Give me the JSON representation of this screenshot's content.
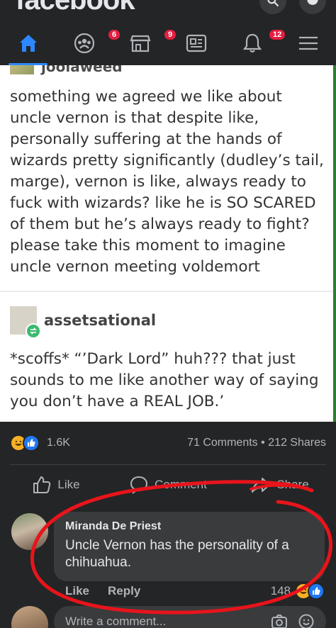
{
  "app": {
    "brand": "facebook"
  },
  "nav": {
    "items": [
      {
        "name": "home",
        "badge": ""
      },
      {
        "name": "groups",
        "badge": "6"
      },
      {
        "name": "marketplace",
        "badge": "9"
      },
      {
        "name": "news",
        "badge": ""
      },
      {
        "name": "notifications",
        "badge": "12"
      },
      {
        "name": "menu",
        "badge": ""
      }
    ]
  },
  "post_image": {
    "first_user": "joolaweed",
    "first_text": "something we agreed we like about uncle vernon is that despite like, personally suffering at the hands of wizards pretty significantly (dudley’s tail, marge), vernon is like, always ready to fuck with wizards? like he is SO SCARED of them but he’s always ready to fight? please take this moment to imagine uncle vernon meeting voldemort",
    "second_user": "assetsational",
    "second_text": "*scoffs* “’Dark Lord” huh??? that just sounds to me like another way of saying you don’t have a REAL JOB.’"
  },
  "reactions": {
    "count": "1.6K",
    "engagement": "71 Comments • 212 Shares"
  },
  "actions": {
    "like": "Like",
    "comment": "Comment",
    "share": "Share"
  },
  "comment": {
    "author": "Miranda De Priest",
    "text": "Uncle Vernon has the personality of a chihuahua.",
    "like_label": "Like",
    "reply_label": "Reply",
    "reaction_count": "148"
  },
  "composer": {
    "placeholder": "Write a comment..."
  },
  "colors": {
    "accent": "#2d88ff",
    "badge": "#e41e3f",
    "annotation": "#e8141b",
    "background": "#242526"
  }
}
